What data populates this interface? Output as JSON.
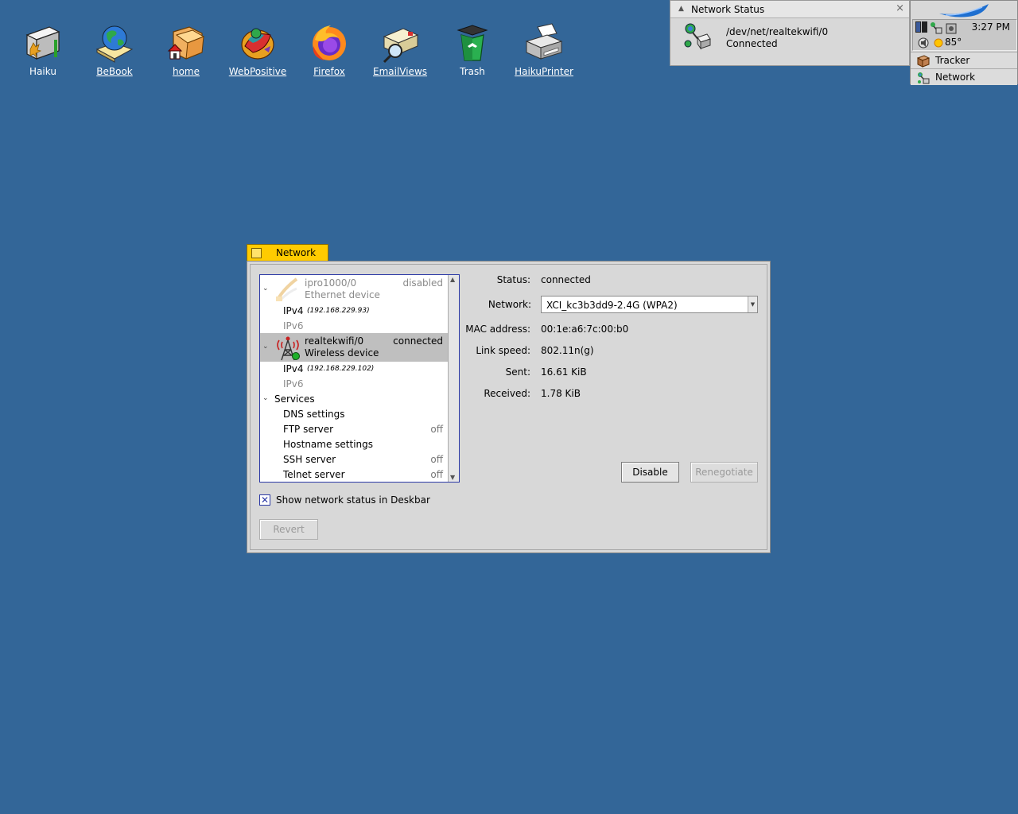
{
  "desktop": {
    "icons": [
      {
        "label": "Haiku",
        "underline": false
      },
      {
        "label": "BeBook",
        "underline": true
      },
      {
        "label": "home",
        "underline": true
      },
      {
        "label": "WebPositive",
        "underline": true
      },
      {
        "label": "Firefox",
        "underline": true
      },
      {
        "label": "EmailViews",
        "underline": true
      },
      {
        "label": "Trash",
        "underline": false
      },
      {
        "label": "HaikuPrinter",
        "underline": true
      }
    ]
  },
  "network_status": {
    "title": "Network Status",
    "close_glyph": "×",
    "collapse_glyph": "▲",
    "device_path": "/dev/net/realtekwifi/0",
    "state": "Connected"
  },
  "deskbar": {
    "clock": "3:27 PM",
    "temperature": "85°",
    "items": [
      {
        "label": "Tracker",
        "icon": "tracker-icon"
      },
      {
        "label": "Network",
        "icon": "network-icon"
      }
    ]
  },
  "network_window": {
    "title": "Network",
    "devices": [
      {
        "name": "ipro1000/0",
        "type": "Ethernet device",
        "state": "disabled",
        "icon": "ethernet-icon"
      },
      {
        "name": "realtekwifi/0",
        "type": "Wireless device",
        "state": "connected",
        "icon": "wifi-tower-icon"
      }
    ],
    "ipv4_label": "IPv4",
    "ipv6_label": "IPv6",
    "ipv4_eth": "(192.168.229.93)",
    "ipv4_wifi": "(192.168.229.102)",
    "services_label": "Services",
    "services": [
      {
        "name": "DNS settings",
        "value": ""
      },
      {
        "name": "FTP server",
        "value": "off"
      },
      {
        "name": "Hostname settings",
        "value": ""
      },
      {
        "name": "SSH server",
        "value": "off"
      },
      {
        "name": "Telnet server",
        "value": "off"
      }
    ],
    "details": {
      "status_label": "Status:",
      "status": "connected",
      "network_label": "Network:",
      "network": "XCI_kc3b3dd9-2.4G (WPA2)",
      "mac_label": "MAC address:",
      "mac": "00:1e:a6:7c:00:b0",
      "speed_label": "Link speed:",
      "speed": "802.11n(g)",
      "sent_label": "Sent:",
      "sent": "16.61 KiB",
      "received_label": "Received:",
      "received": "1.78 KiB"
    },
    "disable_button": "Disable",
    "renegotiate_button": "Renegotiate",
    "show_status_checkbox": "Show network status in Deskbar",
    "show_status_checked": true,
    "revert_button": "Revert"
  },
  "colors": {
    "desktop": "#336698",
    "window_tab": "#ffcb00",
    "focus": "#2b39a6"
  }
}
